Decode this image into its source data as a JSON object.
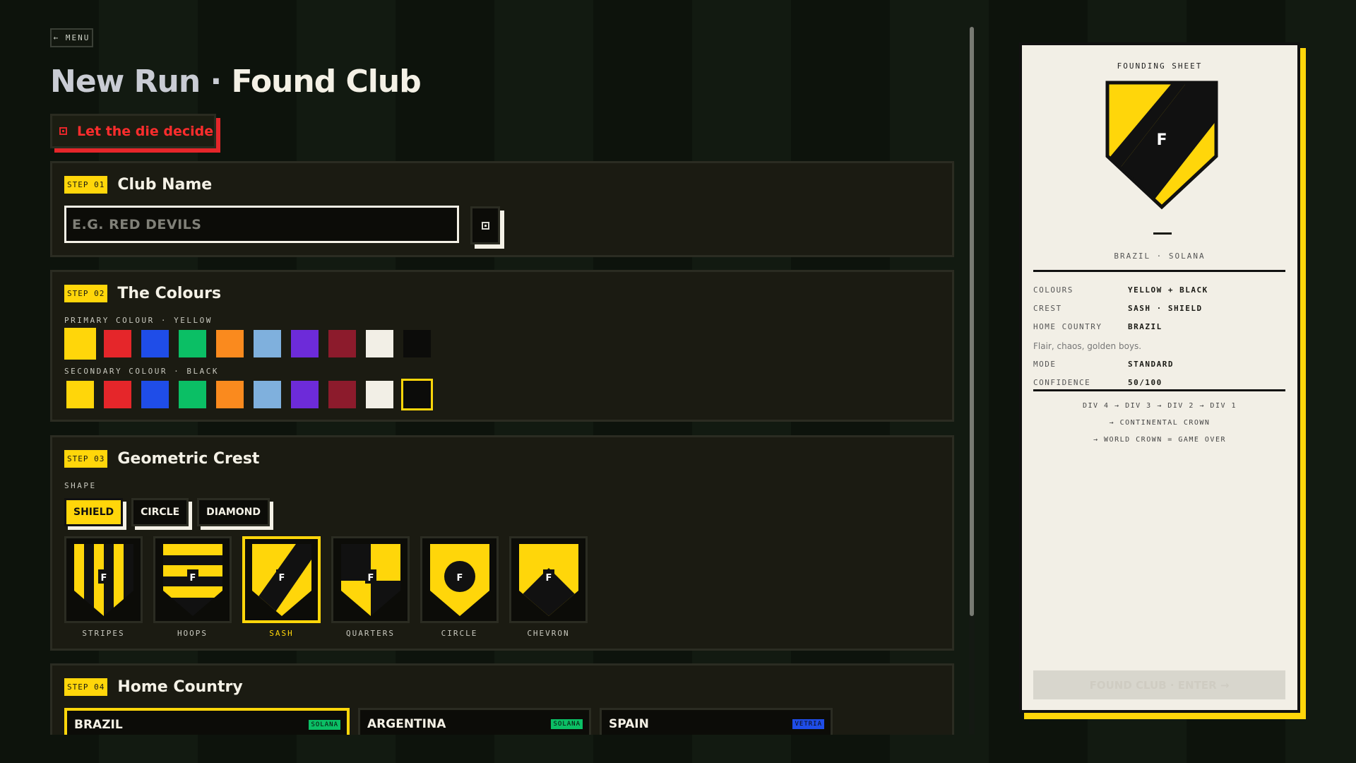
{
  "nav": {
    "menu_label": "← MENU"
  },
  "header": {
    "title_part1": "New Run",
    "title_sep": "·",
    "title_part2": "Found Club"
  },
  "die_button": {
    "label": "Let the die decide",
    "icon": "die-icon"
  },
  "steps": {
    "club_name": {
      "badge": "STEP 01",
      "title": "Club Name",
      "placeholder": "E.G. RED DEVILS",
      "value": ""
    },
    "colours": {
      "badge": "STEP 02",
      "title": "The Colours",
      "primary_label": "PRIMARY COLOUR · YELLOW",
      "secondary_label": "SECONDARY COLOUR · BLACK",
      "swatches": [
        "#ffd60a",
        "#e5262a",
        "#1f4de8",
        "#0bbf65",
        "#fa8a1e",
        "#7fb0dd",
        "#6d2bd9",
        "#8c1b2c",
        "#f2efe6",
        "#0c0c0a"
      ],
      "primary_selected": 0,
      "secondary_selected": 9
    },
    "crest": {
      "badge": "STEP 03",
      "title": "Geometric Crest",
      "shape_label": "SHAPE",
      "shapes": [
        "SHIELD",
        "CIRCLE",
        "DIAMOND"
      ],
      "active_shape": "SHIELD",
      "patterns": [
        "STRIPES",
        "HOOPS",
        "SASH",
        "QUARTERS",
        "CIRCLE",
        "CHEVRON"
      ],
      "selected_pattern": "SASH",
      "crest_letter": "F"
    },
    "country": {
      "badge": "STEP 04",
      "title": "Home Country",
      "options": [
        {
          "name": "BRAZIL",
          "league": "SOLANA",
          "tag_color": "#0bbf65"
        },
        {
          "name": "ARGENTINA",
          "league": "SOLANA",
          "tag_color": "#0bbf65"
        },
        {
          "name": "SPAIN",
          "league": "VETRIA",
          "tag_color": "#1f4de8"
        }
      ],
      "selected": "BRAZIL"
    }
  },
  "sheet": {
    "title": "FOUNDING SHEET",
    "crest_letter": "F",
    "club_name": "—",
    "country_line": "BRAZIL · SOLANA",
    "rows": {
      "colours": {
        "k": "COLOURS",
        "v": "YELLOW + BLACK"
      },
      "crest": {
        "k": "CREST",
        "v": "SASH · SHIELD"
      },
      "home": {
        "k": "HOME COUNTRY",
        "v": "BRAZIL"
      },
      "motto": "Flair, chaos, golden boys.",
      "mode": {
        "k": "MODE",
        "v": "STANDARD"
      },
      "confidence": {
        "k": "CONFIDENCE",
        "v": "50/100"
      }
    },
    "ladder": [
      "DIV 4 → DIV 3 → DIV 2 → DIV 1",
      "→ CONTINENTAL CROWN",
      "→ WORLD CROWN = GAME OVER"
    ],
    "found_button": "FOUND CLUB · ENTER →"
  },
  "colors": {
    "accent": "#ffd60a",
    "danger": "#e5262a",
    "paper": "#f2efe6"
  }
}
